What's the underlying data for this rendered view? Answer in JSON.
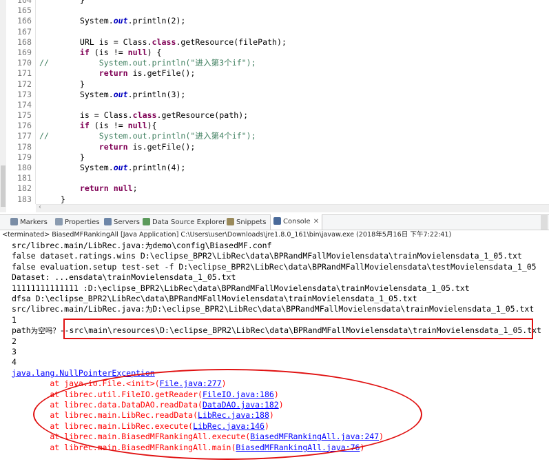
{
  "editor": {
    "lines": [
      {
        "num": "164",
        "text": "        }",
        "segments": [
          {
            "t": "        }"
          }
        ]
      },
      {
        "num": "165",
        "segments": [
          {
            "t": ""
          }
        ]
      },
      {
        "num": "166",
        "segments": [
          {
            "t": "        System."
          },
          {
            "t": "out",
            "c": "fld"
          },
          {
            "t": ".println(2);"
          }
        ]
      },
      {
        "num": "167",
        "segments": [
          {
            "t": ""
          }
        ]
      },
      {
        "num": "168",
        "segments": [
          {
            "t": "        URL is = Class."
          },
          {
            "t": "class",
            "c": "kw"
          },
          {
            "t": ".getResource(filePath);"
          }
        ]
      },
      {
        "num": "169",
        "segments": [
          {
            "t": "        "
          },
          {
            "t": "if",
            "c": "kw"
          },
          {
            "t": " (is != "
          },
          {
            "t": "null",
            "c": "kw"
          },
          {
            "t": ") {"
          }
        ]
      },
      {
        "num": "170",
        "comment": "//",
        "segments": [
          {
            "t": "            System.out.println(\"进入第3个if\");",
            "c": "cm"
          }
        ]
      },
      {
        "num": "171",
        "segments": [
          {
            "t": "            "
          },
          {
            "t": "return",
            "c": "kw"
          },
          {
            "t": " is.getFile();"
          }
        ]
      },
      {
        "num": "172",
        "segments": [
          {
            "t": "        }"
          }
        ]
      },
      {
        "num": "173",
        "segments": [
          {
            "t": "        System."
          },
          {
            "t": "out",
            "c": "fld"
          },
          {
            "t": ".println(3);"
          }
        ]
      },
      {
        "num": "174",
        "segments": [
          {
            "t": ""
          }
        ]
      },
      {
        "num": "175",
        "segments": [
          {
            "t": "        is = Class."
          },
          {
            "t": "class",
            "c": "kw"
          },
          {
            "t": ".getResource(path);"
          }
        ]
      },
      {
        "num": "176",
        "segments": [
          {
            "t": "        "
          },
          {
            "t": "if",
            "c": "kw"
          },
          {
            "t": " (is != "
          },
          {
            "t": "null",
            "c": "kw"
          },
          {
            "t": "){"
          }
        ]
      },
      {
        "num": "177",
        "comment": "//",
        "segments": [
          {
            "t": "            System.out.println(\"进入第4个if\");",
            "c": "cm"
          }
        ]
      },
      {
        "num": "178",
        "segments": [
          {
            "t": "            "
          },
          {
            "t": "return",
            "c": "kw"
          },
          {
            "t": " is.getFile();"
          }
        ]
      },
      {
        "num": "179",
        "segments": [
          {
            "t": "        }"
          }
        ]
      },
      {
        "num": "180",
        "segments": [
          {
            "t": "        System."
          },
          {
            "t": "out",
            "c": "fld"
          },
          {
            "t": ".println(4);"
          }
        ]
      },
      {
        "num": "181",
        "segments": [
          {
            "t": ""
          }
        ]
      },
      {
        "num": "182",
        "segments": [
          {
            "t": "        "
          },
          {
            "t": "return",
            "c": "kw"
          },
          {
            "t": " "
          },
          {
            "t": "null",
            "c": "kw"
          },
          {
            "t": ";"
          }
        ]
      },
      {
        "num": "183",
        "segments": [
          {
            "t": "    }"
          }
        ]
      }
    ]
  },
  "tabs": [
    {
      "label": "Markers",
      "icon": "markers-icon",
      "color": "#7a8da6"
    },
    {
      "label": "Properties",
      "icon": "properties-icon",
      "color": "#8a9bb0"
    },
    {
      "label": "Servers",
      "icon": "servers-icon",
      "color": "#6d86a8"
    },
    {
      "label": "Data Source Explorer",
      "icon": "data-source-icon",
      "color": "#5b9a5b"
    },
    {
      "label": "Snippets",
      "icon": "snippets-icon",
      "color": "#9a8a5b"
    },
    {
      "label": "Console",
      "icon": "console-icon",
      "color": "#4a6a9a",
      "active": true,
      "close": "✕"
    }
  ],
  "console": {
    "header": "<terminated> BiasedMFRankingAll [Java Application] C:\\Users\\user\\Downloads\\jre1.8.0_161\\bin\\javaw.exe (2018年5月16日 下午7:22:41)",
    "lines": [
      {
        "parts": [
          {
            "t": "src/librec.main/LibRec.java:"
          },
          {
            "t": "为",
            "cjk": true
          },
          {
            "t": "demo\\config\\BiasedMF.conf"
          }
        ]
      },
      {
        "parts": [
          {
            "t": "false dataset.ratings.wins D:\\eclipse_BPR2\\LibRec\\data\\BPRandMFallMovielensdata\\trainMovielensdata_1_05.txt"
          }
        ]
      },
      {
        "parts": [
          {
            "t": "false evaluation.setup test-set -f D:\\eclipse_BPR2\\LibRec\\data\\BPRandMFallMovielensdata\\testMovielensdata_1_05"
          }
        ]
      },
      {
        "parts": [
          {
            "t": "Dataset: ...ensdata\\trainMovielensdata_1_05.txt"
          }
        ]
      },
      {
        "parts": [
          {
            "t": "11111111111111 :D:\\eclipse_BPR2\\LibRec\\data\\BPRandMFallMovielensdata\\trainMovielensdata_1_05.txt"
          }
        ]
      },
      {
        "parts": [
          {
            "t": "dfsa D:\\eclipse_BPR2\\LibRec\\data\\BPRandMFallMovielensdata\\trainMovielensdata_1_05.txt"
          }
        ]
      },
      {
        "parts": [
          {
            "t": "src/librec.main/LibRec.java:"
          },
          {
            "t": "为",
            "cjk": true
          },
          {
            "t": "D:\\eclipse_BPR2\\LibRec\\data\\BPRandMFallMovielensdata\\trainMovielensdata_1_05.txt"
          }
        ]
      },
      {
        "parts": [
          {
            "t": "1"
          }
        ]
      },
      {
        "parts": [
          {
            "t": "path"
          },
          {
            "t": "为空吗？",
            "cjk": true
          },
          {
            "t": "--src\\main\\resources\\D:\\eclipse_BPR2\\LibRec\\data\\BPRandMFallMovielensdata\\trainMovielensdata_1_05.txt"
          }
        ]
      },
      {
        "parts": [
          {
            "t": "2"
          }
        ]
      },
      {
        "parts": [
          {
            "t": "3"
          }
        ]
      },
      {
        "parts": [
          {
            "t": "4"
          }
        ]
      },
      {
        "parts": [
          {
            "t": "java.lang.NullPointerException",
            "link": true
          }
        ],
        "red": true
      },
      {
        "parts": [
          {
            "t": "        at java.io.File.<init>("
          },
          {
            "t": "File.java:277",
            "link": true
          },
          {
            "t": ")"
          }
        ],
        "red": true
      },
      {
        "parts": [
          {
            "t": "        at librec.util.FileIO.getReader("
          },
          {
            "t": "FileIO.java:186",
            "link": true
          },
          {
            "t": ")"
          }
        ],
        "red": true
      },
      {
        "parts": [
          {
            "t": "        at librec.data.DataDAO.readData("
          },
          {
            "t": "DataDAO.java:182",
            "link": true
          },
          {
            "t": ")"
          }
        ],
        "red": true
      },
      {
        "parts": [
          {
            "t": "        at librec.main.LibRec.readData("
          },
          {
            "t": "LibRec.java:188",
            "link": true
          },
          {
            "t": ")"
          }
        ],
        "red": true
      },
      {
        "parts": [
          {
            "t": "        at librec.main.LibRec.execute("
          },
          {
            "t": "LibRec.java:146",
            "link": true
          },
          {
            "t": ")"
          }
        ],
        "red": true
      },
      {
        "parts": [
          {
            "t": "        at librec.main.BiasedMFRankingAll.execute("
          },
          {
            "t": "BiasedMFRankingAll.java:247",
            "link": true
          },
          {
            "t": ")"
          }
        ],
        "red": true
      },
      {
        "parts": [
          {
            "t": "        at librec.main.BiasedMFRankingAll.main("
          },
          {
            "t": "BiasedMFRankingAll.java:76",
            "link": true
          },
          {
            "t": ")"
          }
        ],
        "red": true
      }
    ]
  }
}
